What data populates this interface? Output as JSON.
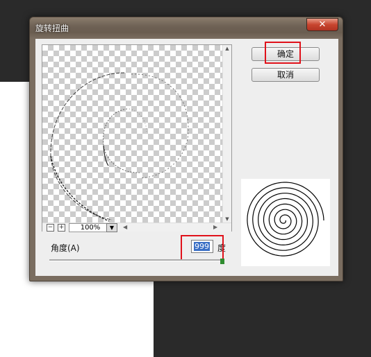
{
  "dialog": {
    "title": "旋转扭曲",
    "close_label": "✕"
  },
  "buttons": {
    "ok_label": "确定",
    "cancel_label": "取消"
  },
  "preview": {
    "zoom_out_label": "−",
    "zoom_in_label": "+",
    "zoom_value": "100%",
    "zoom_dropdown_icon": "chevron-down-icon"
  },
  "angle": {
    "label": "角度(A)",
    "value": "999",
    "unit": "度"
  },
  "highlight_color": "#e0111a"
}
